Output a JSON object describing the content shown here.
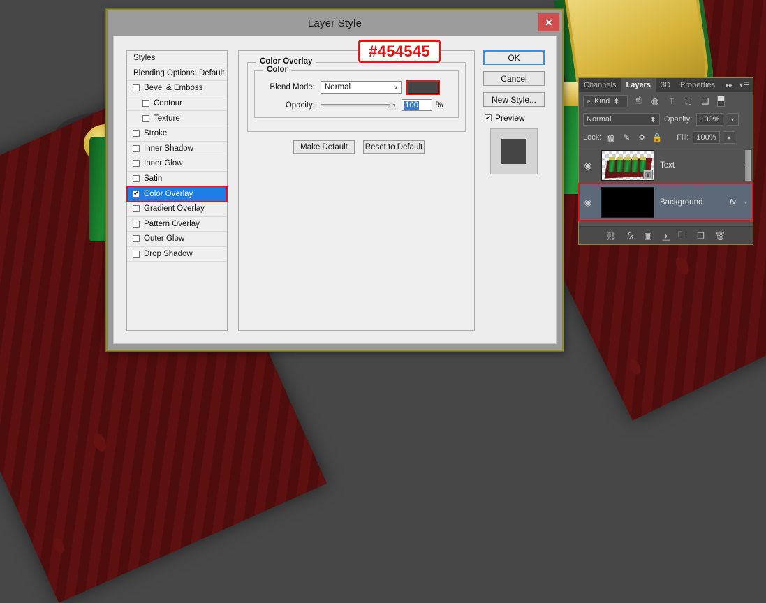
{
  "dialog": {
    "title": "Layer Style",
    "close_label": "✕",
    "styles_header": "Styles",
    "blending_options": "Blending Options: Default",
    "style_items": [
      {
        "label": "Bevel & Emboss",
        "checked": false,
        "indent": false
      },
      {
        "label": "Contour",
        "checked": false,
        "indent": true
      },
      {
        "label": "Texture",
        "checked": false,
        "indent": true
      },
      {
        "label": "Stroke",
        "checked": false,
        "indent": false
      },
      {
        "label": "Inner Shadow",
        "checked": false,
        "indent": false
      },
      {
        "label": "Inner Glow",
        "checked": false,
        "indent": false
      },
      {
        "label": "Satin",
        "checked": false,
        "indent": false
      },
      {
        "label": "Color Overlay",
        "checked": true,
        "indent": false,
        "selected": true
      },
      {
        "label": "Gradient Overlay",
        "checked": false,
        "indent": false
      },
      {
        "label": "Pattern Overlay",
        "checked": false,
        "indent": false
      },
      {
        "label": "Outer Glow",
        "checked": false,
        "indent": false
      },
      {
        "label": "Drop Shadow",
        "checked": false,
        "indent": false
      }
    ],
    "group_color_overlay": "Color Overlay",
    "group_color": "Color",
    "blend_mode_label": "Blend Mode:",
    "blend_mode_value": "Normal",
    "overlay_color": "#454545",
    "opacity_label": "Opacity:",
    "opacity_value": "100",
    "percent_sign": "%",
    "make_default": "Make Default",
    "reset_to_default": "Reset to Default",
    "ok": "OK",
    "cancel": "Cancel",
    "new_style": "New Style...",
    "preview_label": "Preview",
    "preview_checked": "✔",
    "check_glyph": "✔"
  },
  "annotation": {
    "hex_text": "#454545",
    "annotation_color": "#ee1111"
  },
  "layers_panel": {
    "tabs": [
      {
        "label": "Channels",
        "active": false
      },
      {
        "label": "Layers",
        "active": true
      },
      {
        "label": "3D",
        "active": false
      },
      {
        "label": "Properties",
        "active": false
      }
    ],
    "collapse_icon": "▸▸",
    "menu_icon": "▾☰",
    "filter": {
      "search_icon": "search-icon",
      "kind_label": "Kind",
      "stepper": "⬍",
      "icons": [
        "image-filter-icon",
        "adjustment-filter-icon",
        "type-filter-icon",
        "shape-filter-icon",
        "smartobject-filter-icon"
      ],
      "toggle": "filter-toggle"
    },
    "blend_mode": "Normal",
    "opacity_label": "Opacity:",
    "opacity_value": "100%",
    "lock_label": "Lock:",
    "lock_icons": [
      "transparency-lock-icon",
      "paint-lock-icon",
      "move-lock-icon",
      "all-lock-icon"
    ],
    "fill_label": "Fill:",
    "fill_value": "100%",
    "layers": [
      {
        "name": "Text",
        "visible": true,
        "selected": false,
        "has_fx": false,
        "is_3d": true,
        "thumb": "3d-text-scene"
      },
      {
        "name": "Background",
        "visible": true,
        "selected": true,
        "has_fx": true,
        "fx_label": "fx",
        "is_3d": false,
        "thumb": "black-fill",
        "highlighted": true
      }
    ],
    "eye_glyph": "◉",
    "footer_icons": [
      "link-icon",
      "fx-icon",
      "mask-icon",
      "adjustment-icon",
      "group-icon",
      "new-layer-icon",
      "delete-icon"
    ]
  }
}
